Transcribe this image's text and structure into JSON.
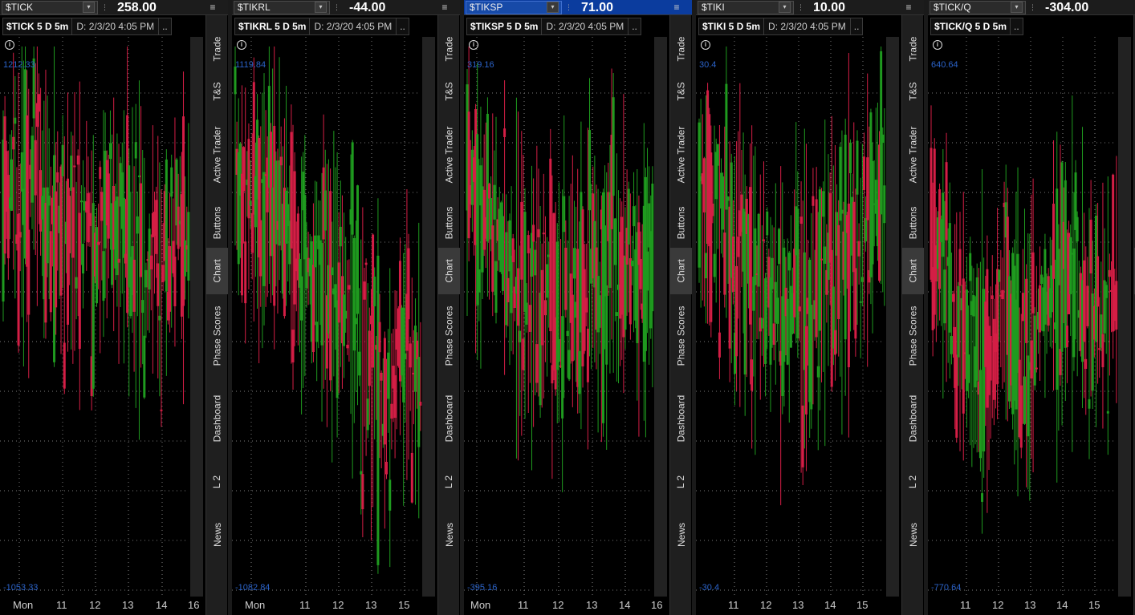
{
  "side_tabs": [
    "Trade",
    "T&S",
    "Active Trader",
    "Buttons",
    "Chart",
    "Phase Scores",
    "Dashboard",
    "L 2",
    "News"
  ],
  "active_tab": "Chart",
  "colors": {
    "up": "#1f9a1f",
    "down": "#d41e45",
    "grid": "#7a7a7a",
    "price_label": "#2b63c9",
    "active_header": "#0b3c9e"
  },
  "icons": {
    "dropdown": "dropdown-arrow-icon",
    "link": "link-icon",
    "menu": "menu-icon",
    "info": "info-icon"
  },
  "panels": [
    {
      "symbol": "$TICK",
      "last": "258.00",
      "title": "$TICK 5 D 5m",
      "date": "D: 2/3/20 4:05 PM",
      "more": "..",
      "high": "1212.33",
      "low": "-1053.33",
      "x_ticks": [
        "Mon",
        "11",
        "12",
        "13",
        "14",
        "16"
      ],
      "active": false
    },
    {
      "symbol": "$TIKRL",
      "last": "-44.00",
      "title": "$TIKRL 5 D 5m",
      "date": "D: 2/3/20 4:05 PM",
      "more": "..",
      "high": "1119.84",
      "low": "-1082.84",
      "x_ticks": [
        "Mon",
        "11",
        "12",
        "13",
        "15"
      ],
      "active": false
    },
    {
      "symbol": "$TIKSP",
      "last": "71.00",
      "title": "$TIKSP 5 D 5m",
      "date": "D: 2/3/20 4:05 PM",
      "more": "..",
      "high": "319.16",
      "low": "-395.16",
      "x_ticks": [
        "Mon",
        "11",
        "12",
        "13",
        "14",
        "16"
      ],
      "active": true
    },
    {
      "symbol": "$TIKI",
      "last": "10.00",
      "title": "$TIKI 5 D 5m",
      "date": "D: 2/3/20 4:05 PM",
      "more": "..",
      "high": "30.4",
      "low": "-30.4",
      "x_ticks": [
        "11",
        "12",
        "13",
        "14",
        "15"
      ],
      "active": false
    },
    {
      "symbol": "$TICK/Q",
      "last": "-304.00",
      "title": "$TICK/Q 5 D 5m",
      "date": "",
      "more": "..",
      "high": "640.64",
      "low": "-770.64",
      "x_ticks": [
        "11",
        "12",
        "13",
        "14",
        "15"
      ],
      "active": false
    }
  ]
}
